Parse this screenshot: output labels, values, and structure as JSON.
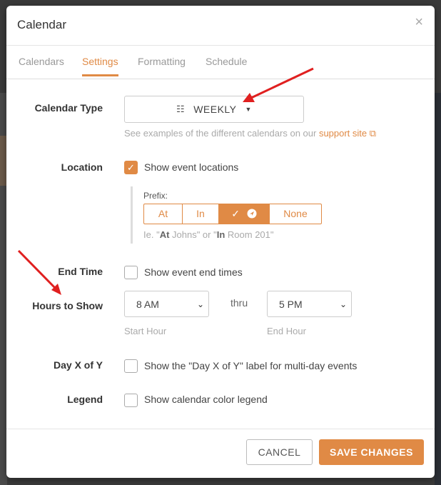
{
  "modal": {
    "title": "Calendar",
    "close_icon": "×"
  },
  "tabs": [
    {
      "label": "Calendars",
      "active": false
    },
    {
      "label": "Settings",
      "active": true
    },
    {
      "label": "Formatting",
      "active": false
    },
    {
      "label": "Schedule",
      "active": false
    }
  ],
  "calendar_type": {
    "label": "Calendar Type",
    "value": "WEEKLY",
    "help_prefix": "See examples of the different calendars on our ",
    "help_link": "support site"
  },
  "location": {
    "label": "Location",
    "checkbox_label": "Show event locations",
    "checked": true,
    "prefix_title": "Prefix:",
    "prefix_options": [
      "At",
      "In",
      "",
      "None"
    ],
    "example_1": "Ie. \"",
    "example_at": "At",
    "example_2": " Johns\" or \"",
    "example_in": "In",
    "example_3": " Room 201\""
  },
  "end_time": {
    "label": "End Time",
    "checkbox_label": "Show event end times",
    "checked": false
  },
  "hours": {
    "label": "Hours to Show",
    "start_value": "8 AM",
    "start_caption": "Start Hour",
    "thru": "thru",
    "end_value": "5 PM",
    "end_caption": "End Hour"
  },
  "day_x_of_y": {
    "label": "Day X of Y",
    "checkbox_label": "Show the \"Day X of Y\" label for multi-day events",
    "checked": false
  },
  "legend": {
    "label": "Legend",
    "checkbox_label": "Show calendar color legend",
    "checked": false
  },
  "footer": {
    "cancel": "CANCEL",
    "save": "SAVE CHANGES"
  },
  "colors": {
    "accent": "#e08a45",
    "annotation_arrow": "#e02020"
  }
}
